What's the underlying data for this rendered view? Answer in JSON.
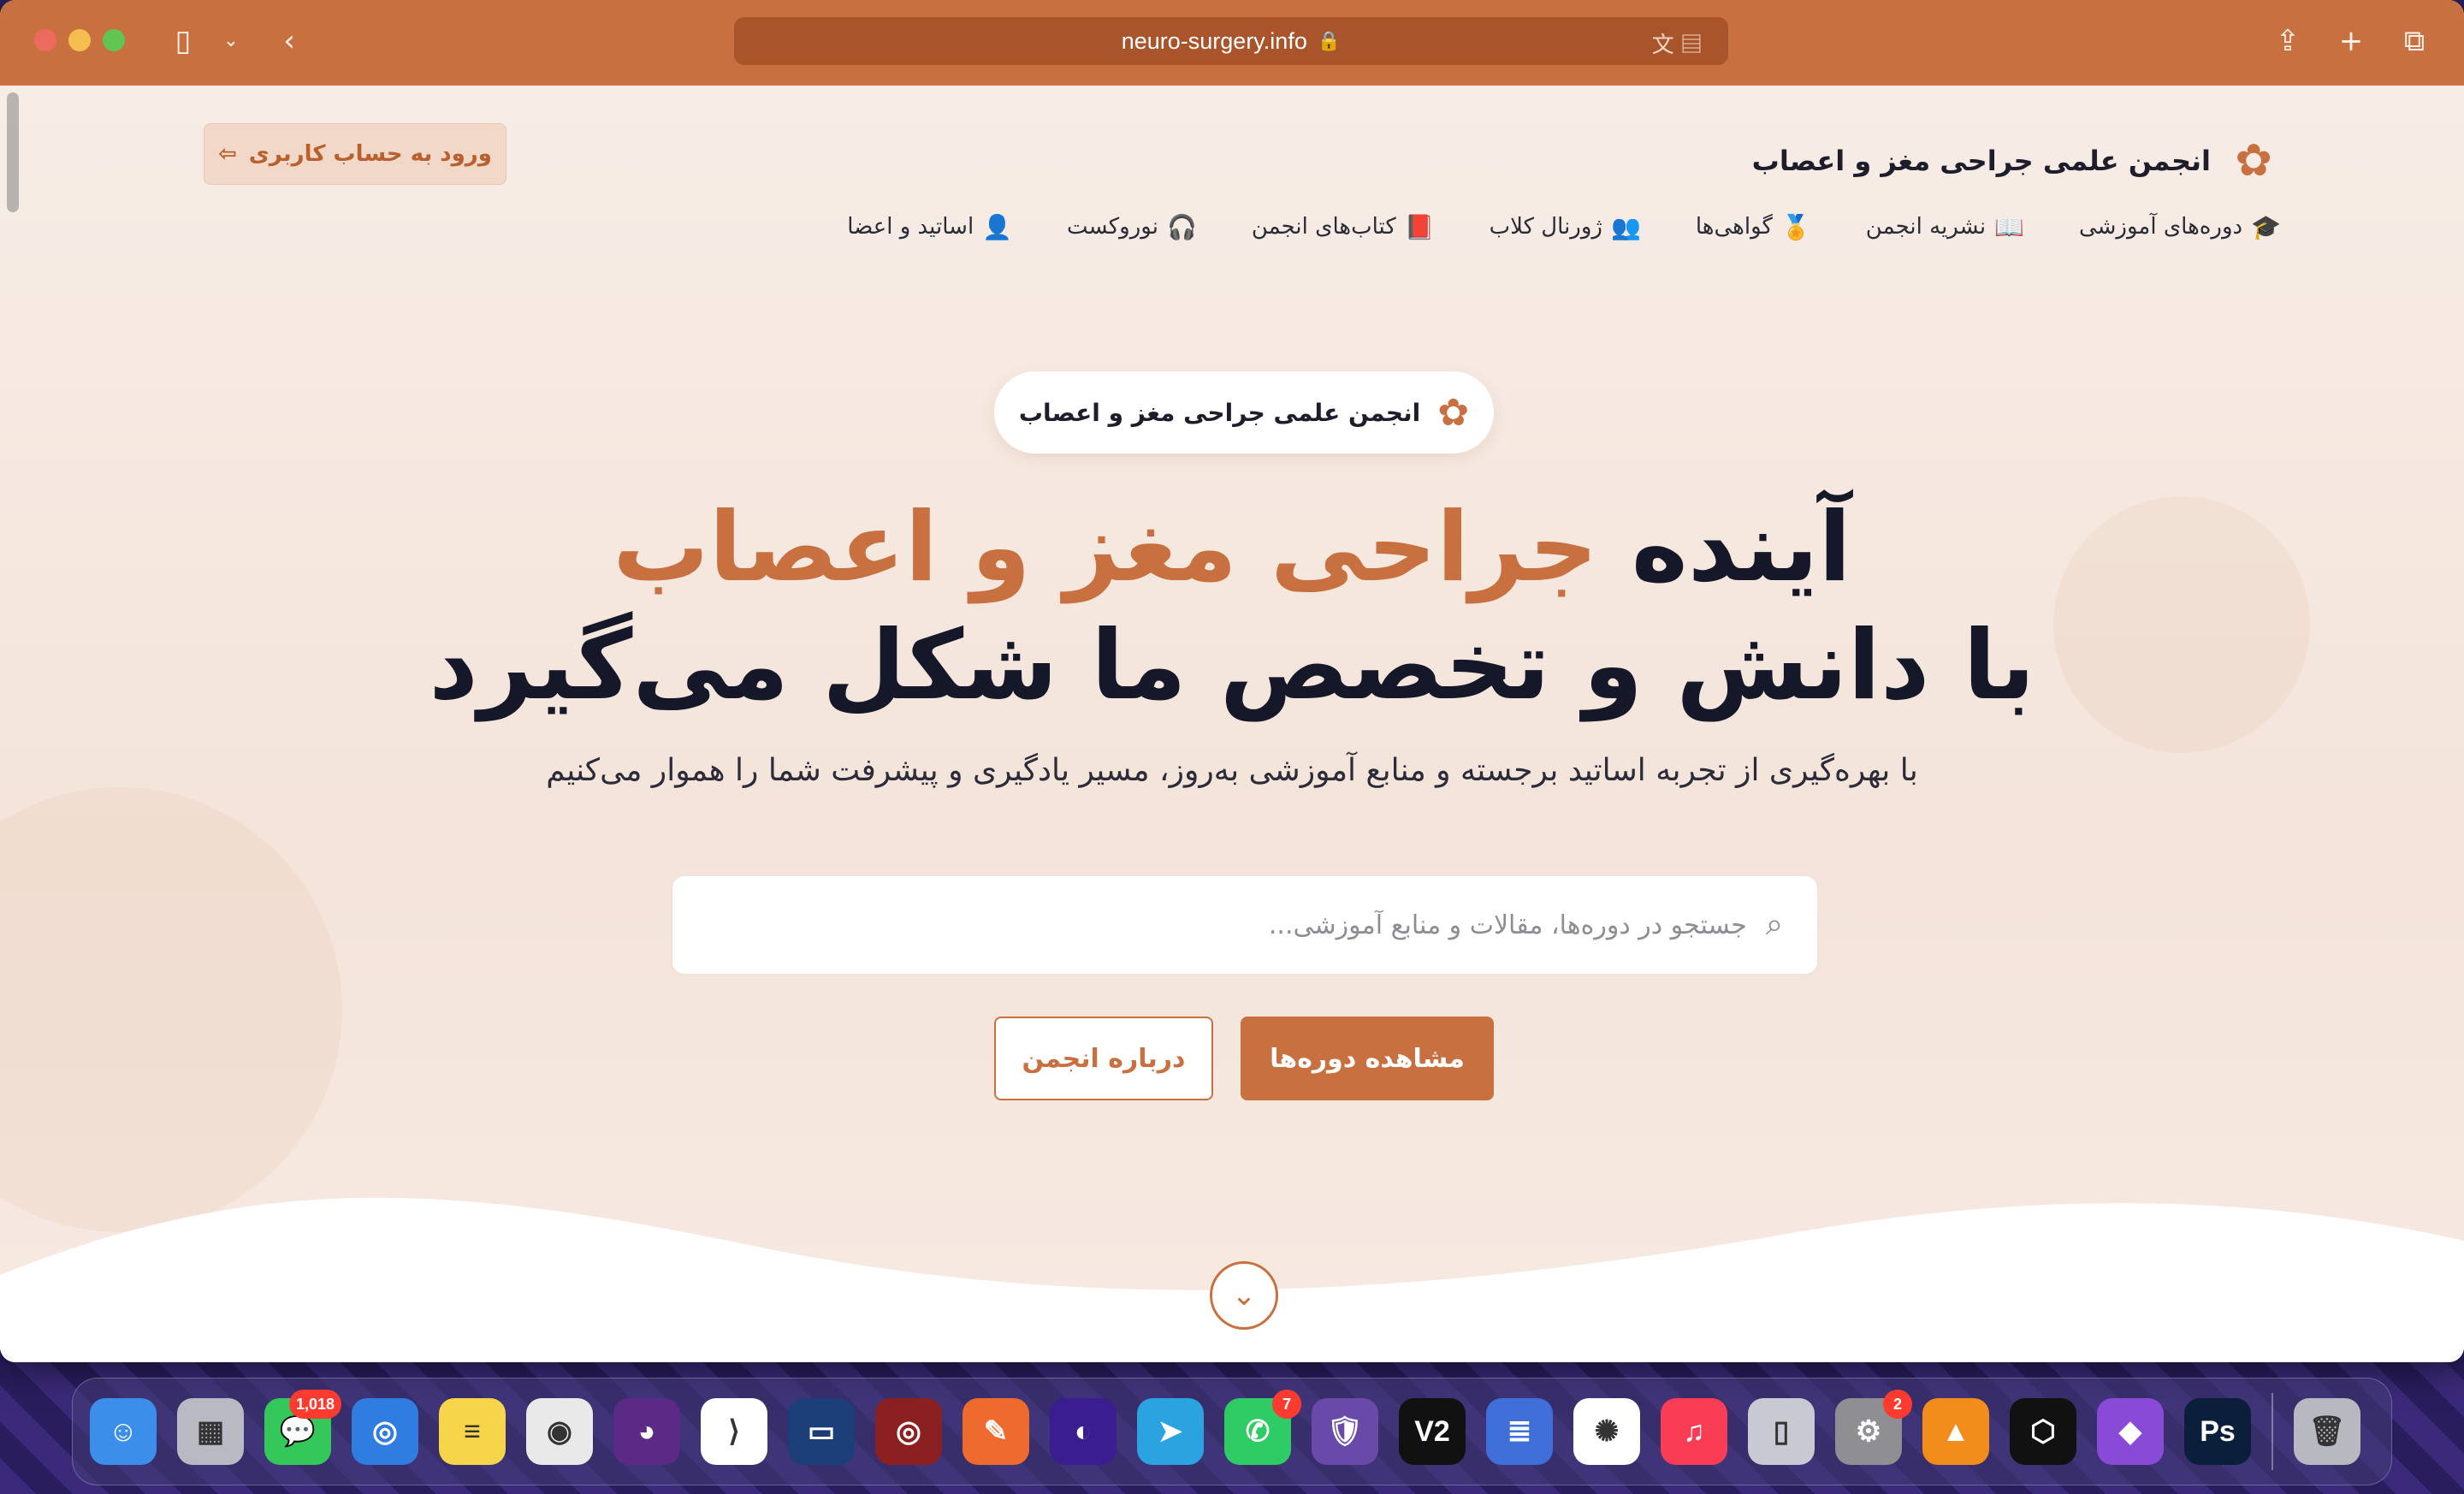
{
  "browser": {
    "url": "neuro-surgery.info"
  },
  "site": {
    "brand_name": "انجمن علمی جراحی مغز و اعصاب",
    "login_label": "ورود به حساب کاربری",
    "nav": [
      {
        "label": "دوره‌های آموزشی",
        "icon": "graduation-cap-icon"
      },
      {
        "label": "نشریه انجمن",
        "icon": "book-open-icon"
      },
      {
        "label": "گواهی‌ها",
        "icon": "award-icon"
      },
      {
        "label": "ژورنال کلاب",
        "icon": "users-icon"
      },
      {
        "label": "کتاب‌های انجمن",
        "icon": "book-icon"
      },
      {
        "label": "نوروکست",
        "icon": "headphones-icon"
      },
      {
        "label": "اساتید و اعضا",
        "icon": "user-check-icon"
      }
    ]
  },
  "hero": {
    "badge_text": "انجمن علمی جراحی مغز و اعصاب",
    "title_prefix": "آینده",
    "title_accent": "جراحی مغز و اعصاب",
    "title_line2": "با دانش و تخصص ما شکل می‌گیرد",
    "subtitle": "با بهره‌گیری از تجربه اساتید برجسته و منابع آموزشی به‌روز، مسیر یادگیری و پیشرفت شما را هموار می‌کنیم",
    "search_placeholder": "جستجو در دوره‌ها، مقالات و منابع آموزشی...",
    "search_value": "",
    "primary_button": "مشاهده دوره‌ها",
    "secondary_button": "درباره انجمن"
  },
  "colors": {
    "accent": "#c8703f",
    "toolbar": "#c8703f",
    "heading": "#141828"
  },
  "dock": {
    "apps": [
      {
        "name": "finder",
        "color": "#3b8eea",
        "glyph": "☺"
      },
      {
        "name": "launchpad",
        "color": "#b9b9c4",
        "glyph": "▦"
      },
      {
        "name": "messages",
        "color": "#34c759",
        "glyph": "💬",
        "badge": "1,018"
      },
      {
        "name": "safari",
        "color": "#2f7de1",
        "glyph": "◎"
      },
      {
        "name": "notes",
        "color": "#f7d54a",
        "glyph": "≡"
      },
      {
        "name": "chrome",
        "color": "#e9e9e9",
        "glyph": "◉"
      },
      {
        "name": "firefox",
        "color": "#5b2a86",
        "glyph": "◕"
      },
      {
        "name": "vscode",
        "color": "#ffffff",
        "glyph": "⟩"
      },
      {
        "name": "app-blue",
        "color": "#1c3f7a",
        "glyph": "▭"
      },
      {
        "name": "database",
        "color": "#8c1f1f",
        "glyph": "◎"
      },
      {
        "name": "pen",
        "color": "#ef6a2d",
        "glyph": "✎"
      },
      {
        "name": "orbit",
        "color": "#3a1e8f",
        "glyph": "◐"
      },
      {
        "name": "telegram",
        "color": "#2aa3e0",
        "glyph": "➤"
      },
      {
        "name": "whatsapp",
        "color": "#2fcc66",
        "glyph": "✆",
        "badge": "7"
      },
      {
        "name": "security",
        "color": "#6a4aa8",
        "glyph": "🛡"
      },
      {
        "name": "v2",
        "color": "#111111",
        "glyph": "V2"
      },
      {
        "name": "docs",
        "color": "#3f6fd8",
        "glyph": "≣"
      },
      {
        "name": "chatgpt",
        "color": "#ffffff",
        "glyph": "✺"
      },
      {
        "name": "music",
        "color": "#fa3d55",
        "glyph": "♫"
      },
      {
        "name": "iphone-mirror",
        "color": "#c9c9d3",
        "glyph": "▯"
      },
      {
        "name": "settings",
        "color": "#8e8e93",
        "glyph": "⚙",
        "badge": "2"
      },
      {
        "name": "vlc",
        "color": "#f28c1a",
        "glyph": "▲"
      },
      {
        "name": "cube",
        "color": "#111111",
        "glyph": "⬡"
      },
      {
        "name": "drop",
        "color": "#8a4ad8",
        "glyph": "◆"
      },
      {
        "name": "photoshop",
        "color": "#0b1f3a",
        "glyph": "Ps"
      },
      {
        "name": "trash",
        "color": "#b8b8c0",
        "glyph": "🗑"
      }
    ]
  }
}
